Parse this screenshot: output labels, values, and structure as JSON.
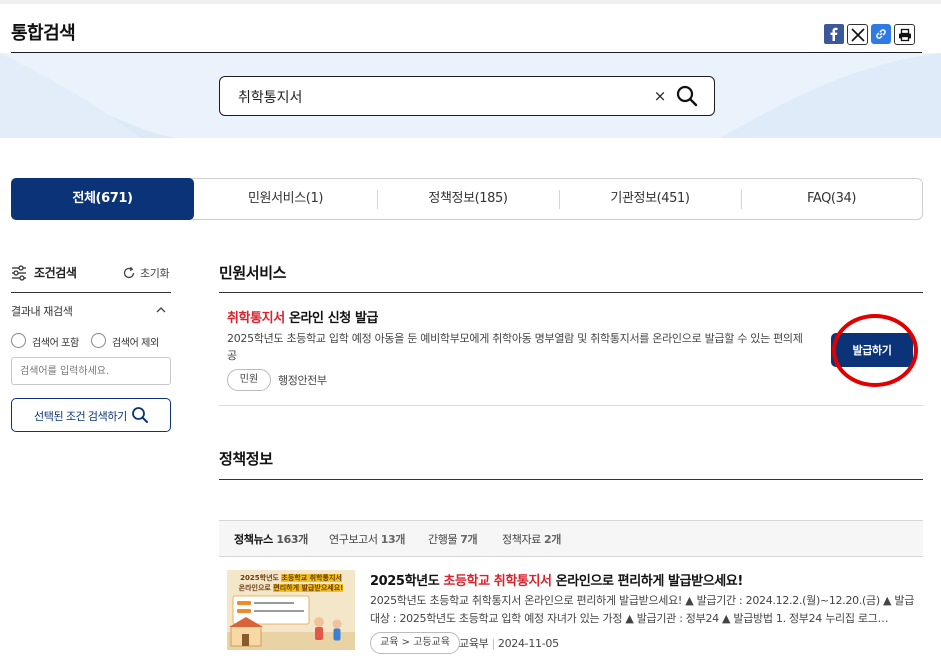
{
  "header": {
    "title": "통합검색",
    "share_icons": [
      "facebook-icon",
      "x-icon",
      "link-icon",
      "print-icon"
    ]
  },
  "search": {
    "query": "취학통지서",
    "clear_label": "×"
  },
  "tabs": [
    {
      "label": "전체(671)",
      "active": true
    },
    {
      "label": "민원서비스(1)",
      "active": false
    },
    {
      "label": "정책정보(185)",
      "active": false
    },
    {
      "label": "기관정보(451)",
      "active": false
    },
    {
      "label": "FAQ(34)",
      "active": false
    }
  ],
  "filter": {
    "title": "조건검색",
    "reset_label": "초기화",
    "re_search_label": "결과내 재검색",
    "include_label": "검색어 포함",
    "exclude_label": "검색어 제외",
    "input_placeholder": "검색어를 입력하세요.",
    "apply_label": "선택된 조건 검색하기"
  },
  "civil_service": {
    "heading": "민원서비스",
    "title_highlight": "취학통지서",
    "title_rest": " 온라인 신청 발급",
    "description": "2025학년도 초등학교 입학 예정 아동을 둔 예비학부모에게 취학아동 명부열람 및 취학통지서를 온라인으로 발급할 수 있는 편의제공",
    "tag": "민원",
    "agency": "행정안전부",
    "button_label": "발급하기"
  },
  "policy": {
    "heading": "정책정보",
    "subtabs": [
      {
        "label": "정책뉴스",
        "count": "163개",
        "active": true
      },
      {
        "label": "연구보고서",
        "count": "13개",
        "active": false
      },
      {
        "label": "간행물",
        "count": "7개",
        "active": false
      },
      {
        "label": "정책자료",
        "count": "2개",
        "active": false
      }
    ],
    "news": {
      "title_pre": "2025학년도 ",
      "title_hl1": "초등학교",
      "title_mid": " ",
      "title_hl2": "취학통지서",
      "title_post": " 온라인으로 편리하게 발급받으세요!",
      "description": "2025학년도 초등학교 취학통지서 온라인으로 편리하게 발급받으세요! ▲ 발급기간 : 2024.12.2.(월)~12.20.(금) ▲ 발급대상 : 2025학년도 초등학교 입학 예정 자녀가 있는 가정 ▲ 발급기관 : 정부24 ▲ 발급방법 1. 정부24 누리집 로그…",
      "tag": "교육 > 고등교육",
      "agency": "교육부",
      "date": "2024-11-05",
      "thumb_line1_a": "2025학년도 ",
      "thumb_line1_b": "초등학교 취학통지서",
      "thumb_line2_a": "온라인으로 ",
      "thumb_line2_b": "편리하게 발급받으세요!"
    }
  },
  "colors": {
    "primary": "#0b3478",
    "highlight": "#d9232d",
    "annotation": "#e00000",
    "band": "#eaf2fb"
  }
}
